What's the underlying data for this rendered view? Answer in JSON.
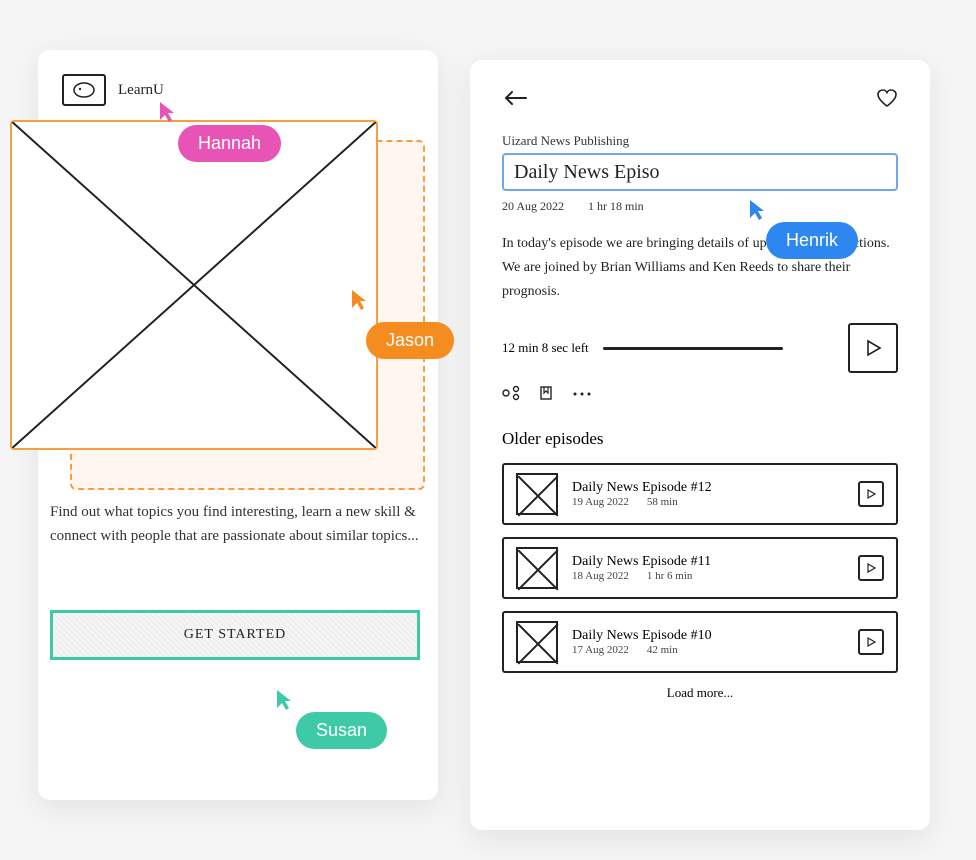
{
  "left": {
    "logo_name": "LearnU",
    "intro": "Find out what topics you find interesting, learn a new skill & connect with people that are passionate about similar topics...",
    "cta_label": "GET STARTED"
  },
  "right": {
    "publisher": "Uizard News Publishing",
    "title_value": "Daily News Episo",
    "date": "20 Aug 2022",
    "duration": "1 hr 18 min",
    "description": "In today's episode we are bringing details of upcoming city elections. We are joined by Brian Williams and Ken Reeds to share their prognosis.",
    "time_left": "12 min 8 sec left",
    "older_title": "Older episodes",
    "episodes": [
      {
        "title": "Daily News Episode #12",
        "date": "19 Aug 2022",
        "duration": "58 min"
      },
      {
        "title": "Daily News Episode #11",
        "date": "18 Aug 2022",
        "duration": "1 hr 6 min"
      },
      {
        "title": "Daily News Episode #10",
        "date": "17 Aug 2022",
        "duration": "42 min"
      }
    ],
    "load_more": "Load more..."
  },
  "collaborators": {
    "hannah": "Hannah",
    "jason": "Jason",
    "susan": "Susan",
    "henrik": "Henrik"
  },
  "colors": {
    "hannah": "#e754b5",
    "jason": "#f58c1f",
    "susan": "#3ec9a7",
    "henrik": "#2e87f0"
  }
}
